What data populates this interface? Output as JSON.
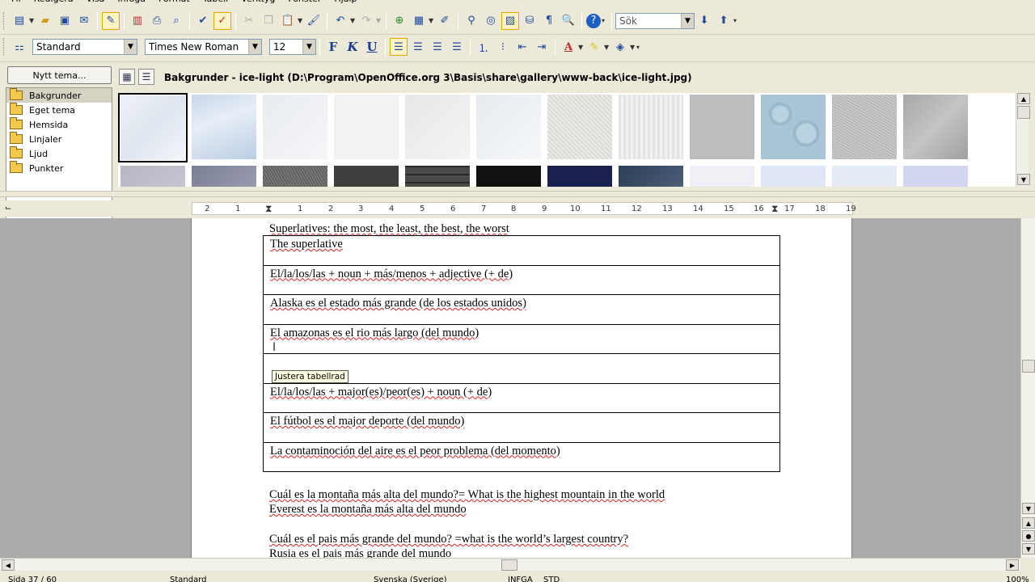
{
  "menu": [
    "Fil",
    "Redigera",
    "Visa",
    "Infoga",
    "Format",
    "Tabell",
    "Verktyg",
    "Fönster",
    "Hjälp"
  ],
  "search": {
    "value": "Sök"
  },
  "format": {
    "style": "Standard",
    "font": "Times New Roman",
    "size": "12"
  },
  "gallery": {
    "new_theme_label": "Nytt tema...",
    "themes": [
      "Bakgrunder",
      "Eget tema",
      "Hemsida",
      "Linjaler",
      "Ljud",
      "Punkter"
    ],
    "selected_theme": "Bakgrunder",
    "title": "Bakgrunder - ice-light (D:\\Program\\OpenOffice.org 3\\Basis\\share\\gallery\\www-back\\ice-light.jpg)"
  },
  "ruler": {
    "ticks": [
      "2",
      "1",
      "1",
      "2",
      "3",
      "4",
      "5",
      "6",
      "7",
      "8",
      "9",
      "10",
      "11",
      "12",
      "13",
      "14",
      "15",
      "16",
      "17",
      "18",
      "19"
    ]
  },
  "document": {
    "heading": "Superlatives: the most, the least, the best, the worst",
    "table_rows": [
      "The superlative",
      "El/la/los/las + noun + más/menos + adjective (+ de)",
      "Alaska es el estado más grande (de los estados unidos)",
      "El amazonas es el rio más largo (del mundo)",
      "",
      "El/la/los/las + major(es)/peor(es) + noun (+ de)",
      "El fútbol es el major deporte (del mundo)",
      "La contaminoción del aire es el peor problema (del momento)"
    ],
    "para1_line1": "Cuál es la montaña más alta del mundo?= What is the highest mountain in the world",
    "para1_line2": "Everest es la montaña más alta del mundo",
    "para2_line1": "Cuál es el pais más grande del mundo? =what is the world’s largest country?",
    "para2_line2": "Rusia es el pais más grande del mundo"
  },
  "tooltip": "Justera tabellrad",
  "status": {
    "page": "Sida 37 / 60",
    "style": "Standard",
    "language": "Svenska (Sverige)",
    "mode": "INFGA",
    "std": "STD",
    "zoom": "100%"
  }
}
